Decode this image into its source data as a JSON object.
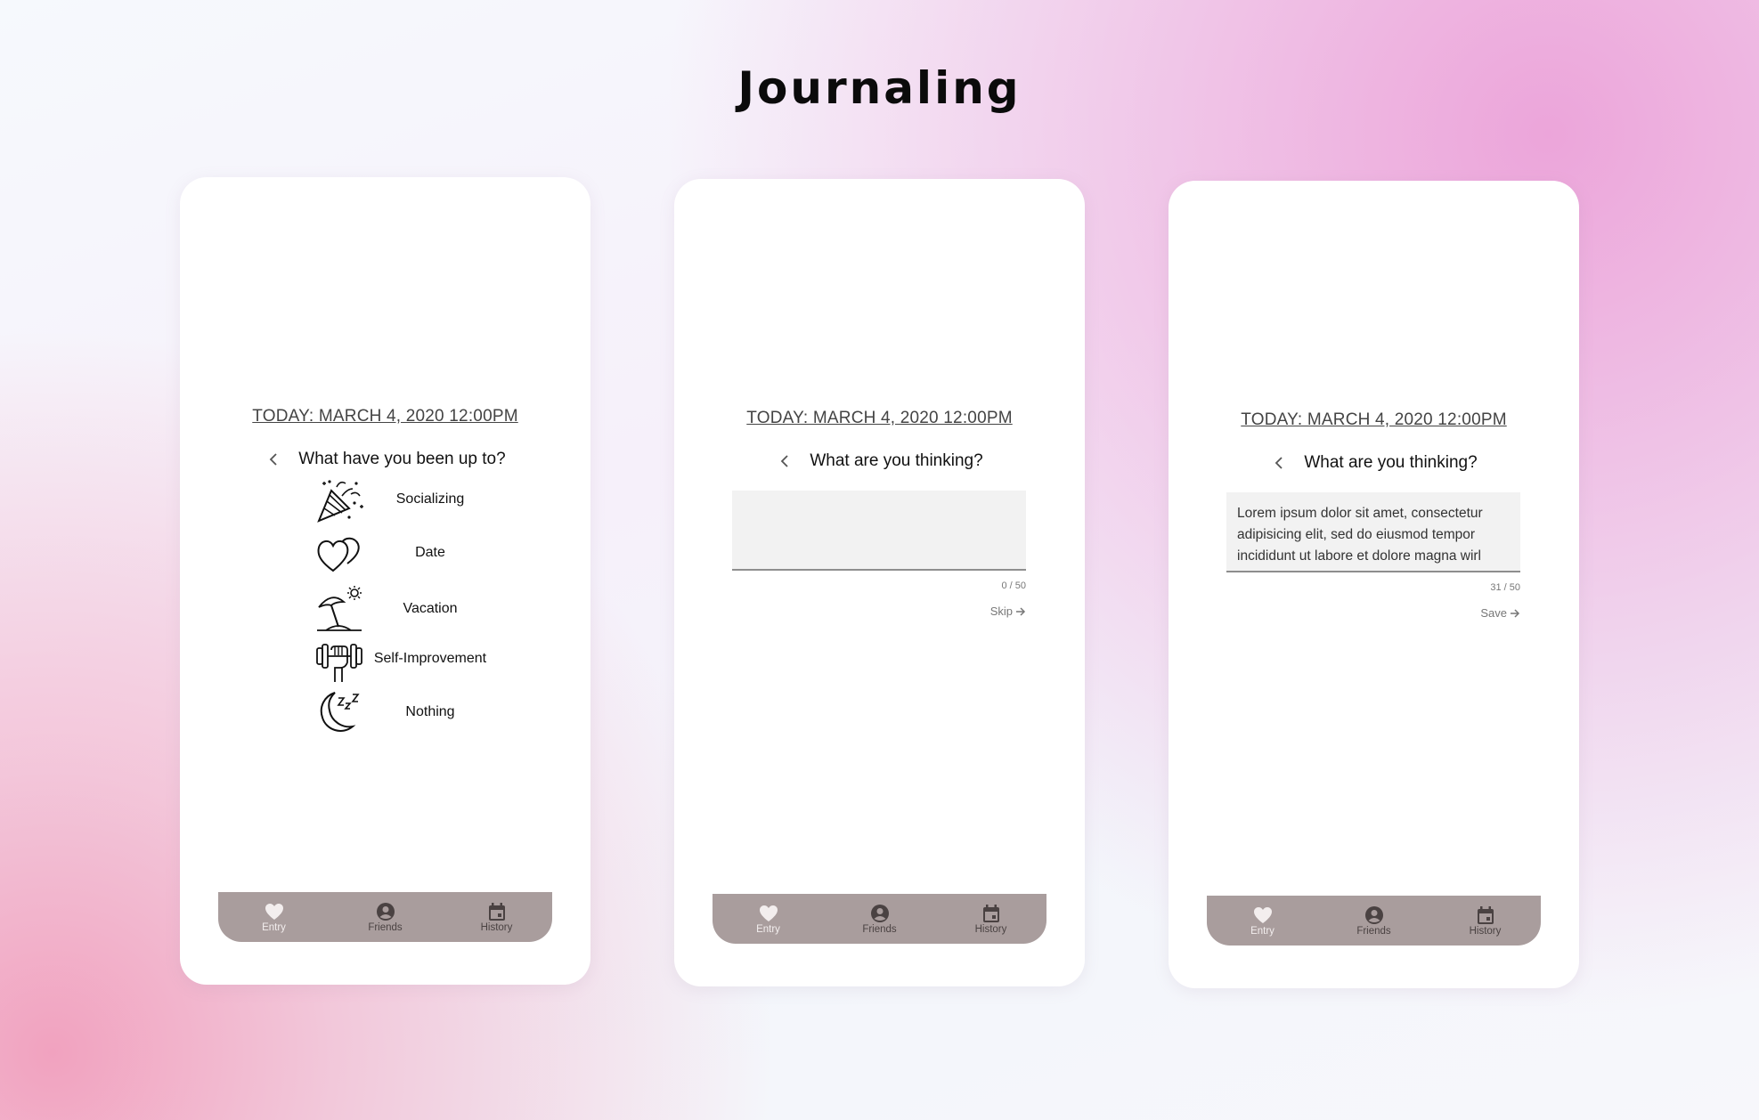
{
  "page": {
    "title": "Journaling"
  },
  "screens": [
    {
      "date": "TODAY: MARCH 4, 2020 12:00PM",
      "question": "What have you been up to?",
      "activities": [
        {
          "label": "Socializing",
          "icon": "party-popper-icon"
        },
        {
          "label": "Date",
          "icon": "two-hearts-icon"
        },
        {
          "label": "Vacation",
          "icon": "beach-umbrella-icon"
        },
        {
          "label": "Self-Improvement",
          "icon": "dumbbell-hand-icon"
        },
        {
          "label": "Nothing",
          "icon": "moon-sleep-icon"
        }
      ]
    },
    {
      "date": "TODAY: MARCH 4, 2020 12:00PM",
      "question": "What are you thinking?",
      "text": "",
      "counter": "0 / 50",
      "action_label": "Skip"
    },
    {
      "date": "TODAY: MARCH 4, 2020 12:00PM",
      "question": "What are you thinking?",
      "text": "Lorem ipsum dolor sit amet, consectetur adipisicing elit, sed do eiusmod tempor incididunt ut labore et dolore magna wirl",
      "counter": "31 / 50",
      "action_label": "Save"
    }
  ],
  "nav": {
    "items": [
      {
        "label": "Entry",
        "icon": "heart-icon"
      },
      {
        "label": "Friends",
        "icon": "account-circle-icon"
      },
      {
        "label": "History",
        "icon": "calendar-icon"
      }
    ],
    "active_color": "#f3eeee",
    "inactive_color": "#4a4242",
    "bar_color": "#a99d9d"
  }
}
